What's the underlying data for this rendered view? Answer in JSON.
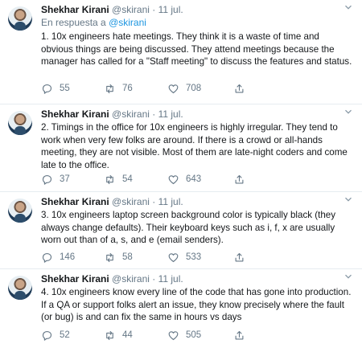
{
  "tweets": [
    {
      "name": "Shekhar Kirani",
      "handle": "@skirani",
      "dot_date": "· 11 jul.",
      "reply_prefix": "En respuesta a ",
      "reply_handle": "@skirani",
      "text": "1. 10x engineers hate meetings. They think it is a waste of time and obvious things are being discussed. They attend meetings because the manager has called for a \"Staff meeting\" to discuss the features and status.",
      "replies": "55",
      "retweets": "76",
      "likes": "708"
    },
    {
      "name": "Shekhar Kirani",
      "handle": "@skirani",
      "dot_date": "· 11 jul.",
      "text": "2. Timings in the office for 10x engineers is highly irregular. They tend to work when very few folks are around. If there is a crowd or all-hands meeting, they are not visible. Most of them are late-night coders and come late to the office.",
      "replies": "37",
      "retweets": "54",
      "likes": "643"
    },
    {
      "name": "Shekhar Kirani",
      "handle": "@skirani",
      "dot_date": "· 11 jul.",
      "text": "3. 10x engineers laptop screen background color is typically black (they always change defaults). Their keyboard keys such as i, f, x are usually worn out than of a, s, and e (email senders).",
      "replies": "146",
      "retweets": "58",
      "likes": "533"
    },
    {
      "name": "Shekhar Kirani",
      "handle": "@skirani",
      "dot_date": "· 11 jul.",
      "text": "4. 10x engineers know every line of the code that has gone into production. If a QA or support folks alert an issue, they know precisely where the fault (or bug) is and can fix the same in hours vs days",
      "replies": "52",
      "retweets": "44",
      "likes": "505"
    }
  ],
  "icons": {
    "reply": "reply-icon",
    "retweet": "retweet-icon",
    "like": "heart-icon",
    "share": "share-icon",
    "menu": "chevron-down-icon"
  },
  "colors": {
    "text": "#14171a",
    "muted": "#657786",
    "link": "#1b95e0",
    "divider": "#e6ecf0"
  }
}
